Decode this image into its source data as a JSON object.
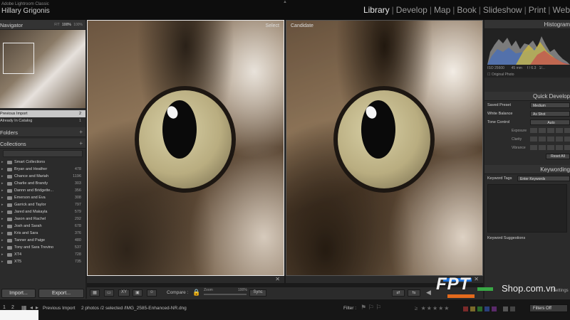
{
  "app": {
    "brand": "Adobe Lightroom Classic",
    "user": "Hillary Grigonis"
  },
  "modules": [
    "Library",
    "Develop",
    "Map",
    "Book",
    "Slideshow",
    "Print",
    "Web"
  ],
  "active_module": "Library",
  "navigator": {
    "title": "Navigator",
    "zoom_options": [
      "FIT",
      "100%",
      "100%"
    ],
    "active_zoom": "100%"
  },
  "catalog": {
    "items": [
      {
        "label": "Previous Import",
        "count": "2"
      },
      {
        "label": "Already In Catalog",
        "count": "1"
      }
    ]
  },
  "folders": {
    "title": "Folders",
    "plus": "+"
  },
  "collections": {
    "title": "Collections",
    "plus": "+",
    "items": [
      {
        "label": "Smart Collections",
        "count": ""
      },
      {
        "label": "Bryan and Heather",
        "count": "478"
      },
      {
        "label": "Chance and Mariah",
        "count": "1196"
      },
      {
        "label": "Charlie and Brandy",
        "count": "303"
      },
      {
        "label": "Dannn and Bridgette...",
        "count": "356"
      },
      {
        "label": "Emerson and Eva",
        "count": "308"
      },
      {
        "label": "Garrick and Taylor",
        "count": "797"
      },
      {
        "label": "Jared and Makayla",
        "count": "579"
      },
      {
        "label": "Jason and Rachel",
        "count": "292"
      },
      {
        "label": "Josh and Sarah",
        "count": "678"
      },
      {
        "label": "Kris and Sara",
        "count": "376"
      },
      {
        "label": "Tanner and Paige",
        "count": "480"
      },
      {
        "label": "Tony and Sara Trevino",
        "count": "537"
      },
      {
        "label": "XT4",
        "count": "728"
      },
      {
        "label": "XT5",
        "count": "735"
      }
    ]
  },
  "left_buttons": {
    "import": "Import...",
    "export": "Export..."
  },
  "compare": {
    "select_label": "Select",
    "candidate_label": "Candidate",
    "compare_label": "Compare :",
    "zoom_label": "Zoom",
    "zoom_value": "100%",
    "sync_label": "Sync"
  },
  "right": {
    "histogram_title": "Histogram",
    "histogram_meta": [
      "ISO 25600",
      "45 mm",
      "f / 6.3",
      "1/..."
    ],
    "original_photo": "Original Photo",
    "quick_develop_title": "Quick Develop",
    "saved_preset_label": "Saved Preset",
    "saved_preset_value": "Medium",
    "white_balance_label": "White Balance",
    "white_balance_value": "As Shot",
    "tone_control_label": "Tone Control",
    "tone_control_value": "Auto",
    "exposure_label": "Exposure",
    "clarity_label": "Clarity",
    "vibrance_label": "Vibrance",
    "reset_all": "Reset All",
    "keywording_title": "Keywording",
    "keyword_tags_label": "Keyword Tags",
    "keyword_tags_value": "Enter Keywords",
    "keyword_suggestions": "Keyword Suggestions",
    "settings_label": "Settings"
  },
  "bottom": {
    "page1": "1",
    "page2": "2",
    "source": "Previous Import",
    "selection": "2 photos /2 selected /IMG_2585-Enhanced-NR.dng",
    "filter_label": "Filter :",
    "filters_off": "Filters Off"
  },
  "watermark": {
    "brand": "FPT",
    "shop": "Shop.com.vn"
  },
  "colors": {
    "brand_blue": "#1b6fd8",
    "brand_orange": "#e46a1d",
    "brand_green": "#39a845"
  }
}
